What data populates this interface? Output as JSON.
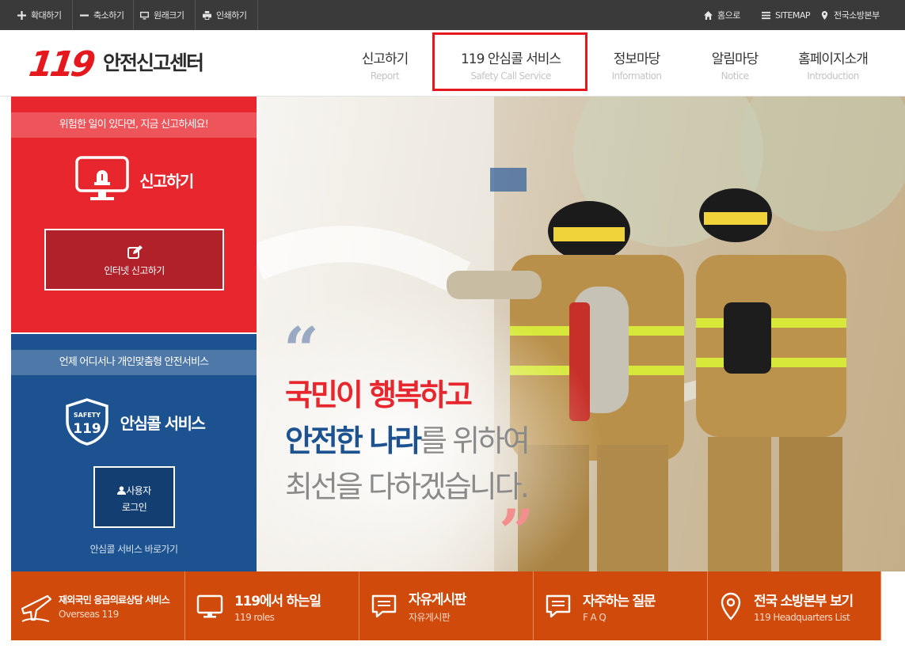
{
  "topbar": {
    "zoom_in": "확대하기",
    "zoom_out": "축소하기",
    "original_size": "원래크기",
    "print": "인쇄하기",
    "home": "홈으로",
    "sitemap": "SITEMAP",
    "hq": "전국소방본부"
  },
  "header": {
    "logo_mark": "119",
    "logo_text": "안전신고센터",
    "nav": [
      {
        "ko": "신고하기",
        "en": "Report"
      },
      {
        "ko": "119 안심콜 서비스",
        "en": "Safety Call Service"
      },
      {
        "ko": "정보마당",
        "en": "Information"
      },
      {
        "ko": "알림마당",
        "en": "Notice"
      },
      {
        "ko": "홈페이지소개",
        "en": "Introduction"
      }
    ]
  },
  "report_panel": {
    "banner": "위험한 일이 있다면, 지금 신고하세요!",
    "title": "신고하기",
    "button": "인터넷 신고하기"
  },
  "safety_panel": {
    "banner": "언제 어디서나 개인맞춤형 안전서비스",
    "badge_top": "SAFETY",
    "badge_num": "119",
    "title": "안심콜 서비스",
    "button_line1": "사용자",
    "button_line2": "로그인",
    "shortcut": "안심콜 서비스 바로가기"
  },
  "hero": {
    "line1_red": "국민이 행복하고",
    "line2_blue": "안전한 나라",
    "line2_gray": "를 위하여",
    "line3_gray": "최선을 다하겠습니다."
  },
  "quick_links": [
    {
      "title": "재외국민 응급의료상담 서비스",
      "sub": "Overseas 119"
    },
    {
      "title": "119에서 하는일",
      "sub": "119 roles"
    },
    {
      "title": "자유게시판",
      "sub": "자유게시판"
    },
    {
      "title": "자주하는 질문",
      "sub": "F A Q"
    },
    {
      "title": "전국 소방본부 보기",
      "sub": "119 Headquarters List"
    }
  ],
  "colors": {
    "red": "#e8262d",
    "blue": "#1c5290",
    "orange": "#d04a0b",
    "topbar": "#3a3a3a"
  }
}
